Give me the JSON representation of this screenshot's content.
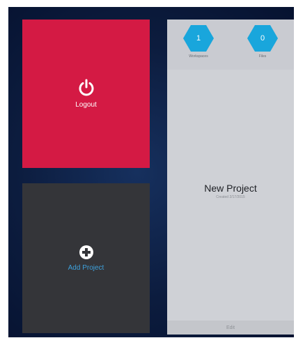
{
  "tiles": {
    "logout": {
      "label": "Logout",
      "color": "#d41a44",
      "icon": "power-icon"
    },
    "add_project": {
      "label": "Add Project",
      "color": "#343539",
      "label_color": "#3ea1dc",
      "icon": "plus-circle-icon"
    }
  },
  "project": {
    "title": "New Project",
    "created": "Created 2/17/2015",
    "stats": [
      {
        "value": "1",
        "label": "Workspaces"
      },
      {
        "value": "0",
        "label": "Files"
      }
    ],
    "edit_label": "Edit",
    "accent": "#19a6dc"
  }
}
